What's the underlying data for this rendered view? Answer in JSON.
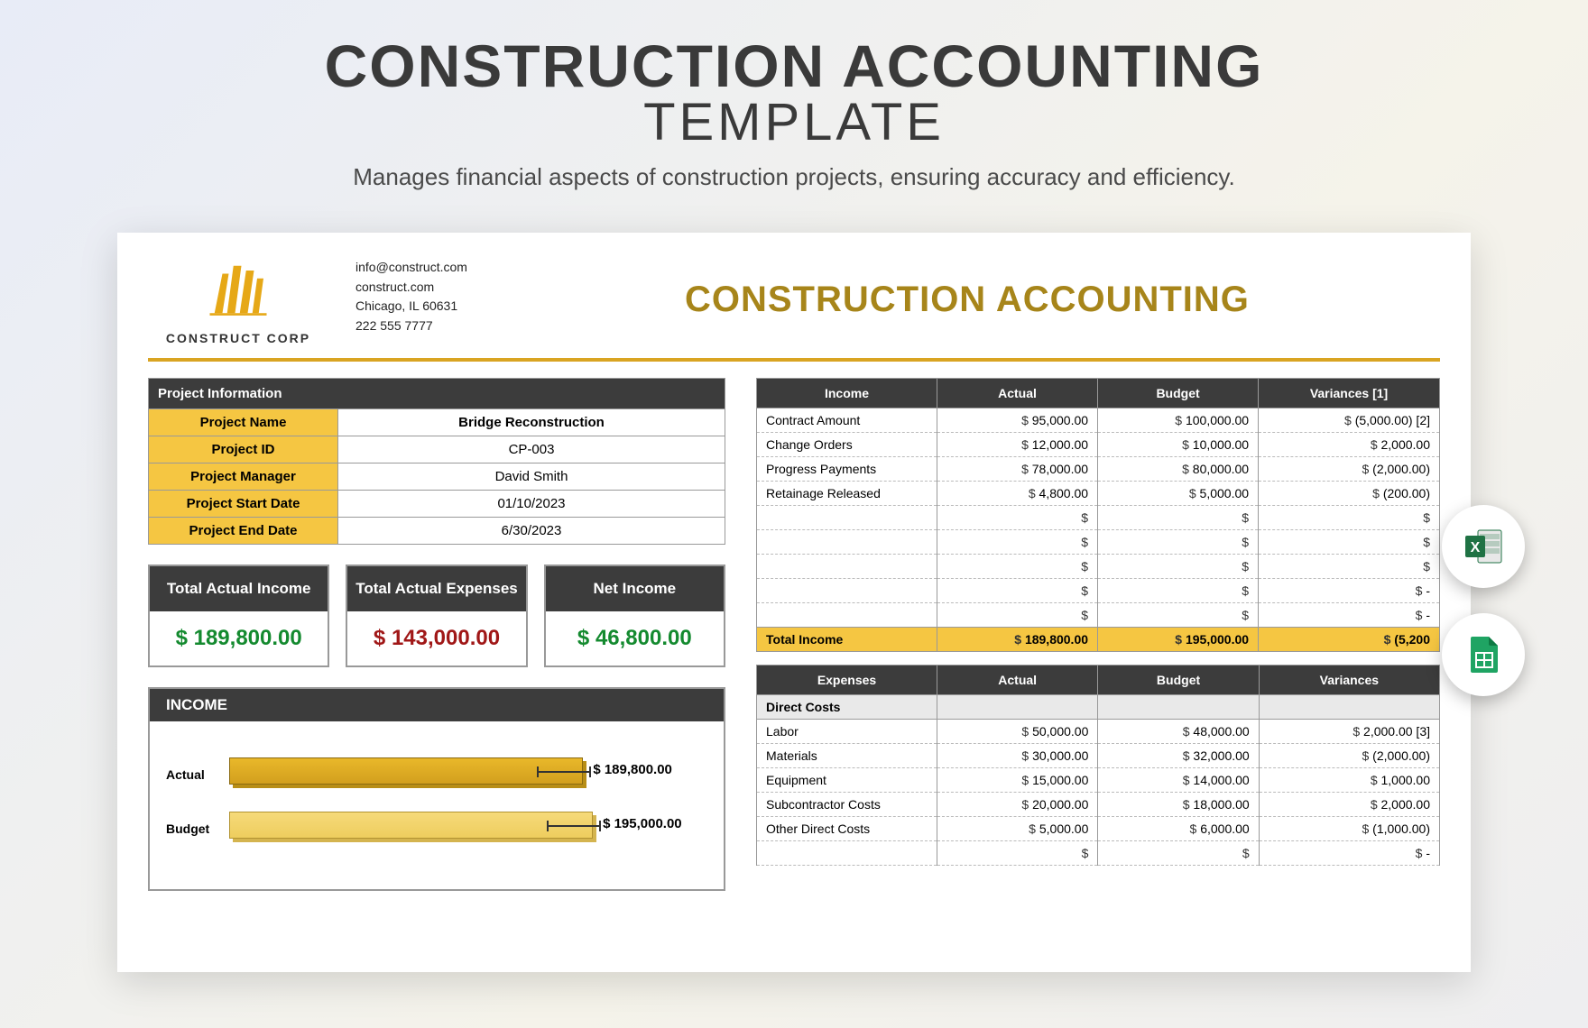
{
  "hero": {
    "title_line1": "CONSTRUCTION ACCOUNTING",
    "title_line2": "TEMPLATE",
    "subtitle": "Manages financial aspects of construction projects, ensuring accuracy and efficiency."
  },
  "company": {
    "name": "CONSTRUCT CORP",
    "email": "info@construct.com",
    "web": "construct.com",
    "address": "Chicago, IL 60631",
    "phone": "222 555 7777"
  },
  "doc_title": "CONSTRUCTION ACCOUNTING",
  "project": {
    "header": "Project Information",
    "rows": [
      {
        "label": "Project Name",
        "value": "Bridge Reconstruction",
        "bold": true
      },
      {
        "label": "Project ID",
        "value": "CP-003"
      },
      {
        "label": "Project Manager",
        "value": "David Smith"
      },
      {
        "label": "Project Start Date",
        "value": "01/10/2023"
      },
      {
        "label": "Project End Date",
        "value": "6/30/2023"
      }
    ]
  },
  "totals": {
    "income_label": "Total Actual Income",
    "income_value": "$  189,800.00",
    "expenses_label": "Total Actual Expenses",
    "expenses_value": "$  143,000.00",
    "net_label": "Net Income",
    "net_value": "$  46,800.00"
  },
  "income_chart_title": "INCOME",
  "income_table": {
    "headers": [
      "Income",
      "Actual",
      "Budget",
      "Variances [1]"
    ],
    "rows": [
      {
        "label": "Contract Amount",
        "actual": "95,000.00",
        "budget": "100,000.00",
        "variance": "(5,000.00) [2]"
      },
      {
        "label": "Change Orders",
        "actual": "12,000.00",
        "budget": "10,000.00",
        "variance": "2,000.00"
      },
      {
        "label": "Progress Payments",
        "actual": "78,000.00",
        "budget": "80,000.00",
        "variance": "(2,000.00)"
      },
      {
        "label": "Retainage Released",
        "actual": "4,800.00",
        "budget": "5,000.00",
        "variance": "(200.00)"
      }
    ],
    "empty_rows": 5,
    "total_label": "Total Income",
    "total_actual": "189,800.00",
    "total_budget": "195,000.00",
    "total_variance": "(5,200"
  },
  "expenses_table": {
    "headers": [
      "Expenses",
      "Actual",
      "Budget",
      "Variances"
    ],
    "section": "Direct Costs",
    "rows": [
      {
        "label": "Labor",
        "actual": "50,000.00",
        "budget": "48,000.00",
        "variance": "2,000.00  [3]"
      },
      {
        "label": "Materials",
        "actual": "30,000.00",
        "budget": "32,000.00",
        "variance": "(2,000.00)"
      },
      {
        "label": "Equipment",
        "actual": "15,000.00",
        "budget": "14,000.00",
        "variance": "1,000.00"
      },
      {
        "label": "Subcontractor Costs",
        "actual": "20,000.00",
        "budget": "18,000.00",
        "variance": "2,000.00"
      },
      {
        "label": "Other Direct Costs",
        "actual": "5,000.00",
        "budget": "6,000.00",
        "variance": "(1,000.00)"
      }
    ]
  },
  "chart_data": {
    "type": "bar",
    "orientation": "horizontal",
    "title": "INCOME",
    "categories": [
      "Actual",
      "Budget"
    ],
    "values": [
      189800.0,
      195000.0
    ],
    "value_labels": [
      "$ 189,800.00",
      "$ 195,000.00"
    ],
    "xlim": [
      0,
      200000
    ]
  }
}
